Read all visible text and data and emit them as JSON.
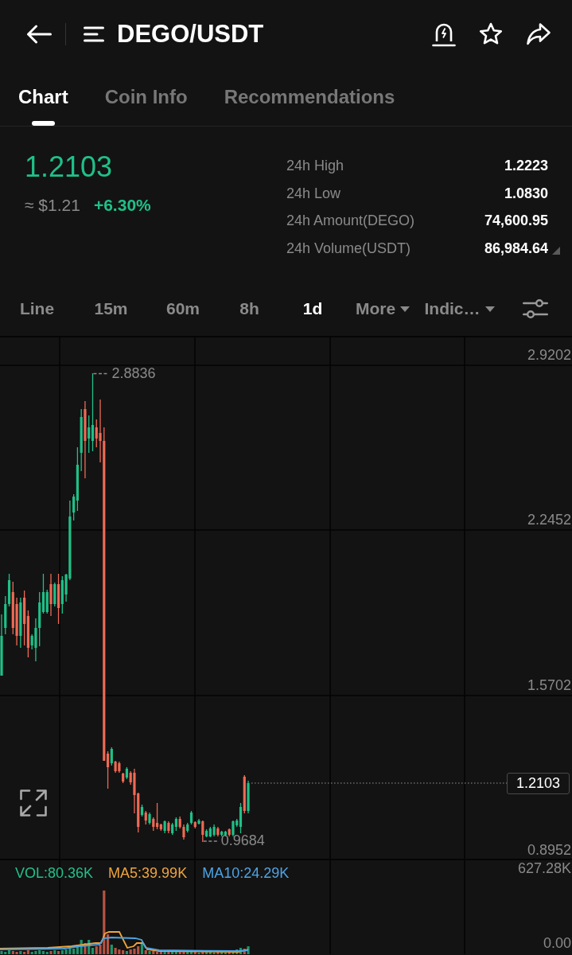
{
  "header": {
    "title": "DEGO/USDT"
  },
  "tabs": [
    {
      "label": "Chart",
      "selected": true
    },
    {
      "label": "Coin Info",
      "selected": false
    },
    {
      "label": "Recommendations",
      "selected": false
    }
  ],
  "ticker": {
    "last_price": "1.2103",
    "fiat_price": "≈ $1.21",
    "change": "+6.30%",
    "rising": true
  },
  "stats": [
    {
      "label": "24h High",
      "value": "1.2223"
    },
    {
      "label": "24h Low",
      "value": "1.0830"
    },
    {
      "label": "24h Amount(DEGO)",
      "value": "74,600.95"
    },
    {
      "label": "24h Volume(USDT)",
      "value": "86,984.64"
    }
  ],
  "intervals": [
    {
      "label": "Line",
      "kind": "option",
      "selected": false
    },
    {
      "label": "15m",
      "kind": "option",
      "selected": false
    },
    {
      "label": "60m",
      "kind": "option",
      "selected": false
    },
    {
      "label": "8h",
      "kind": "option",
      "selected": false
    },
    {
      "label": "1d",
      "kind": "option",
      "selected": true
    },
    {
      "label": "More",
      "kind": "dropdown",
      "selected": false
    },
    {
      "label": "Indic…",
      "kind": "dropdown",
      "selected": false
    }
  ],
  "price_chart": {
    "axis_labels": [
      "2.9202",
      "2.2452",
      "1.5702",
      "0.8952"
    ],
    "high_label": "2.8836",
    "low_label": "0.9684",
    "last_price_tag": "1.2103"
  },
  "volume_chart": {
    "readings": [
      {
        "label": "VOL:80.36K",
        "color": "#22c08a"
      },
      {
        "label": "MA5:39.99K",
        "color": "#f0a53c"
      },
      {
        "label": "MA10:24.29K",
        "color": "#4ea4e3"
      }
    ],
    "axis_labels": [
      "627.28K",
      "0.00"
    ]
  }
}
